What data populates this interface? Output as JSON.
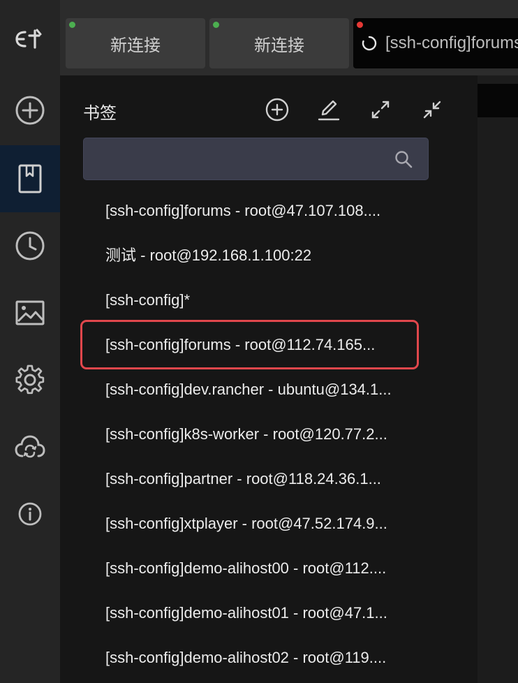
{
  "tabs": [
    {
      "label": "新连接",
      "status_color": "#4caf50"
    },
    {
      "label": "新连接",
      "status_color": "#4caf50"
    },
    {
      "label": "[ssh-config]forums",
      "status_color": "#e53935"
    }
  ],
  "rail": {
    "items": [
      "add-icon",
      "bookmark-icon",
      "history-icon",
      "image-icon",
      "gear-icon",
      "cloud-sync-icon",
      "info-icon"
    ],
    "active_index": 1
  },
  "panel": {
    "title": "书签",
    "search": {
      "value": "",
      "placeholder": ""
    },
    "tools": [
      "add-circle-icon",
      "edit-icon",
      "expand-icon",
      "collapse-icon"
    ]
  },
  "bookmarks": [
    "[ssh-config]forums - root@47.107.108....",
    "测试 - root@192.168.1.100:22",
    "[ssh-config]*",
    "[ssh-config]forums - root@112.74.165...",
    "[ssh-config]dev.rancher - ubuntu@134.1...",
    "[ssh-config]k8s-worker - root@120.77.2...",
    "[ssh-config]partner - root@118.24.36.1...",
    "[ssh-config]xtplayer - root@47.52.174.9...",
    "[ssh-config]demo-alihost00 - root@112....",
    "[ssh-config]demo-alihost01 - root@47.1...",
    "[ssh-config]demo-alihost02 - root@119...."
  ],
  "highlighted_index": 3,
  "colors": {
    "accent_highlight": "#e0474c",
    "rail_active": "#0f1f33"
  }
}
